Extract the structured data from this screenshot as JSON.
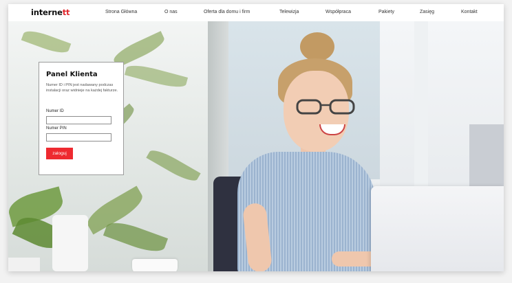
{
  "header": {
    "logo_text": "interne",
    "logo_accent": "tt",
    "nav": [
      {
        "label": "Strona Główna"
      },
      {
        "label": "O nas"
      },
      {
        "label": "Oferta dla domu i firm"
      },
      {
        "label": "Telewizja"
      },
      {
        "label": "Współpraca"
      },
      {
        "label": "Pakiety"
      },
      {
        "label": "Zasięg"
      },
      {
        "label": "Kontakt"
      }
    ]
  },
  "login_panel": {
    "title": "Panel Klienta",
    "description": "Numer ID i PIN jest nadawany podczas instalacji oraz widnieje na każdej fakturze.",
    "id_label": "Numer ID",
    "id_value": "",
    "pin_label": "Numer PIN",
    "pin_value": "",
    "submit_label": "zaloguj"
  },
  "colors": {
    "accent": "#ee2a30",
    "text": "#111111"
  }
}
